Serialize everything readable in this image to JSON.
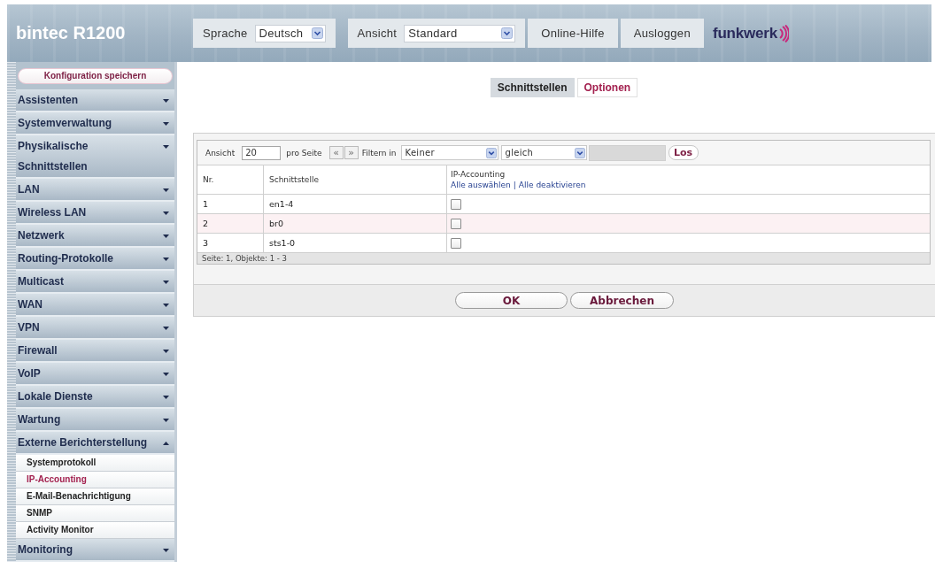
{
  "header": {
    "product": "bintec R1200",
    "language_label": "Sprache",
    "language": "Deutsch",
    "view_label": "Ansicht",
    "view": "Standard",
    "links": [
      "Online-Hilfe",
      "Ausloggen"
    ],
    "logo": "funkwerk"
  },
  "sidebar": {
    "save_button": "Konfiguration speichern",
    "items": [
      {
        "label": "Assistenten",
        "expanded": false
      },
      {
        "label": "Systemverwaltung",
        "expanded": false
      },
      {
        "label": "Physikalische Schnittstellen",
        "expanded": false
      },
      {
        "label": "LAN",
        "expanded": false
      },
      {
        "label": "Wireless LAN",
        "expanded": false
      },
      {
        "label": "Netzwerk",
        "expanded": false
      },
      {
        "label": "Routing-Protokolle",
        "expanded": false
      },
      {
        "label": "Multicast",
        "expanded": false
      },
      {
        "label": "WAN",
        "expanded": false
      },
      {
        "label": "VPN",
        "expanded": false
      },
      {
        "label": "Firewall",
        "expanded": false
      },
      {
        "label": "VoIP",
        "expanded": false
      },
      {
        "label": "Lokale Dienste",
        "expanded": false
      },
      {
        "label": "Wartung",
        "expanded": false
      },
      {
        "label": "Externe Berichterstellung",
        "expanded": true,
        "children": [
          {
            "label": "Systemprotokoll",
            "selected": false
          },
          {
            "label": "IP-Accounting",
            "selected": true
          },
          {
            "label": "E-Mail-Benachrichtigung",
            "selected": false
          },
          {
            "label": "SNMP",
            "selected": false
          },
          {
            "label": "Activity Monitor",
            "selected": false
          }
        ]
      },
      {
        "label": "Monitoring",
        "expanded": false
      }
    ]
  },
  "tabs": [
    {
      "label": "Schnittstellen",
      "selected": true
    },
    {
      "label": "Optionen",
      "selected": false
    }
  ],
  "filter": {
    "view_label": "Ansicht",
    "per_page": "20",
    "per_page_label": "pro Seite",
    "pager": [
      {
        "label": "«",
        "disabled": true
      },
      {
        "label": "»",
        "disabled": true
      }
    ],
    "filter_label": "Filtern in",
    "field": "Keiner",
    "operator": "gleich",
    "go_button": "Los"
  },
  "table": {
    "columns": [
      "Nr.",
      "Schnittstelle",
      "IP-Accounting"
    ],
    "bulk_links": [
      "Alle auswählen",
      "Alle deaktivieren"
    ],
    "bulk_separator": "|",
    "rows": [
      {
        "nr": "1",
        "interface": "en1-4",
        "ip_accounting": false,
        "highlighted": false
      },
      {
        "nr": "2",
        "interface": "br0",
        "ip_accounting": false,
        "highlighted": true
      },
      {
        "nr": "3",
        "interface": "sts1-0",
        "ip_accounting": false,
        "highlighted": false
      }
    ],
    "footer": "Seite: 1, Objekte: 1 - 3"
  },
  "buttons": [
    "OK",
    "Abbrechen"
  ]
}
